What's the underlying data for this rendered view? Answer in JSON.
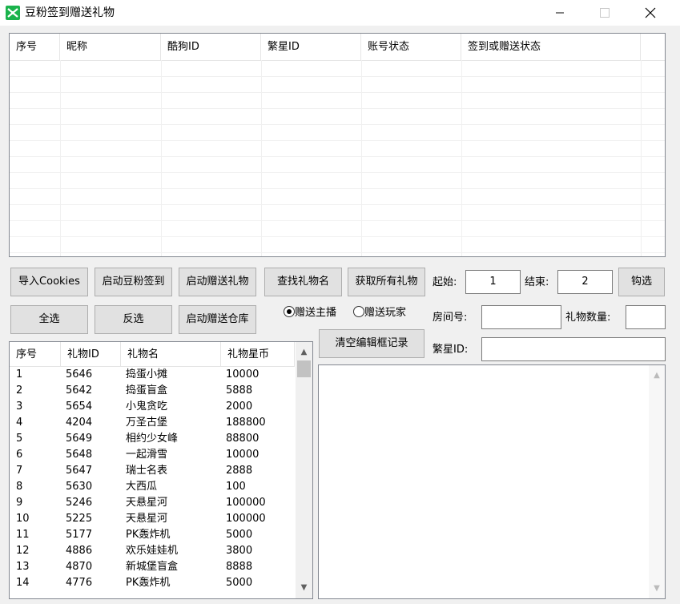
{
  "window": {
    "title": "豆粉签到赠送礼物"
  },
  "accounts": {
    "columns": [
      "序号",
      "昵称",
      "酷狗ID",
      "繁星ID",
      "账号状态",
      "签到或赠送状态"
    ],
    "rows": []
  },
  "buttons": {
    "import_cookies": "导入Cookies",
    "start_sign": "启动豆粉签到",
    "start_gift": "启动赠送礼物",
    "find_gift": "查找礼物名",
    "get_all_gifts": "获取所有礼物",
    "check": "钩选",
    "select_all": "全选",
    "invert": "反选",
    "start_gift_warehouse": "启动赠送仓库",
    "clear_log": "清空编辑框记录"
  },
  "labels": {
    "start": "起始:",
    "end": "结束:",
    "room_no": "房间号:",
    "gift_count": "礼物数量:",
    "fanxing_id": "繁星ID:"
  },
  "fields": {
    "start": "1",
    "end": "2",
    "room_no": "",
    "gift_count": "",
    "fanxing_id": ""
  },
  "radios": {
    "to_anchor": "赠送主播",
    "to_player": "赠送玩家",
    "selected": "to_anchor"
  },
  "gifts": {
    "columns": [
      "序号",
      "礼物ID",
      "礼物名",
      "礼物星币"
    ],
    "rows": [
      {
        "no": "1",
        "id": "5646",
        "name": "捣蛋小摊",
        "price": "10000"
      },
      {
        "no": "2",
        "id": "5642",
        "name": "捣蛋盲盒",
        "price": "5888"
      },
      {
        "no": "3",
        "id": "5654",
        "name": "小鬼贪吃",
        "price": "2000"
      },
      {
        "no": "4",
        "id": "4204",
        "name": "万圣古堡",
        "price": "188800"
      },
      {
        "no": "5",
        "id": "5649",
        "name": "相约少女峰",
        "price": "88800"
      },
      {
        "no": "6",
        "id": "5648",
        "name": "一起滑雪",
        "price": "10000"
      },
      {
        "no": "7",
        "id": "5647",
        "name": "瑞士名表",
        "price": "2888"
      },
      {
        "no": "8",
        "id": "5630",
        "name": "大西瓜",
        "price": "100"
      },
      {
        "no": "9",
        "id": "5246",
        "name": "天悬星河",
        "price": "100000"
      },
      {
        "no": "10",
        "id": "5225",
        "name": "天悬星河",
        "price": "100000"
      },
      {
        "no": "11",
        "id": "5177",
        "name": "PK轰炸机",
        "price": "5000"
      },
      {
        "no": "12",
        "id": "4886",
        "name": "欢乐娃娃机",
        "price": "3800"
      },
      {
        "no": "13",
        "id": "4870",
        "name": "新城堡盲盒",
        "price": "8888"
      },
      {
        "no": "14",
        "id": "4776",
        "name": "PK轰炸机",
        "price": "5000"
      }
    ]
  }
}
